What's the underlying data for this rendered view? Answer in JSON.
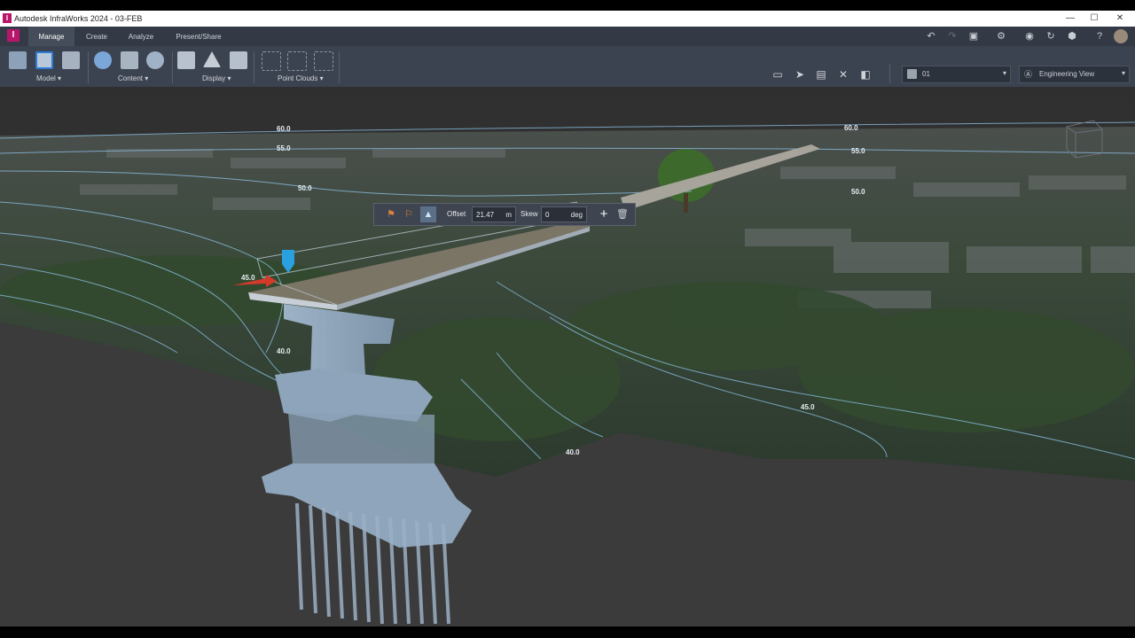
{
  "window": {
    "title": "Autodesk InfraWorks 2024 - 03-FEB",
    "app_badge": "I",
    "controls": {
      "minimize": "—",
      "maximize": "☐",
      "close": "✕"
    }
  },
  "ribbon": {
    "tabs": [
      "Manage",
      "Create",
      "Analyze",
      "Present/Share"
    ],
    "active_tab": "Manage",
    "groups": [
      {
        "label": "Model",
        "icon_names": [
          "model-explorer-icon",
          "proposal-icon",
          "style-palette-icon"
        ]
      },
      {
        "label": "Content",
        "icon_names": [
          "data-sources-icon",
          "city-icon",
          "internet-icon"
        ]
      },
      {
        "label": "Display",
        "icon_names": [
          "layers-icon",
          "terrain-icon",
          "legend-icon"
        ]
      },
      {
        "label": "Point Clouds",
        "icon_names": [
          "point-cloud-icon",
          "point-cloud-terrain-icon",
          "point-cloud-edit-icon"
        ]
      }
    ],
    "group_dropdown_arrow": "▾",
    "proposal_dropdown": {
      "value": "01"
    },
    "view_dropdown": {
      "value": "Engineering View"
    }
  },
  "viewport": {
    "contour_labels": [
      "60.0",
      "55.0",
      "50.0",
      "45.0",
      "40.0",
      "60.0",
      "55.0",
      "50.0",
      "45.0",
      "40.0"
    ],
    "floating_toolbar": {
      "offset_label": "Offset",
      "offset_value": "21.47",
      "offset_unit": "m",
      "skew_label": "Skew",
      "skew_value": "0",
      "skew_unit": "deg",
      "add_symbol": "+",
      "delete_symbol": "🗑"
    }
  },
  "colors": {
    "title_bar": "#ffffff",
    "ribbon_tabs": "#333a46",
    "ribbon_panel": "#3c4350",
    "accent_logo": "#b8156b",
    "contour_line": "#8fc4ea",
    "viewport_bg": "#3a3a3a"
  }
}
